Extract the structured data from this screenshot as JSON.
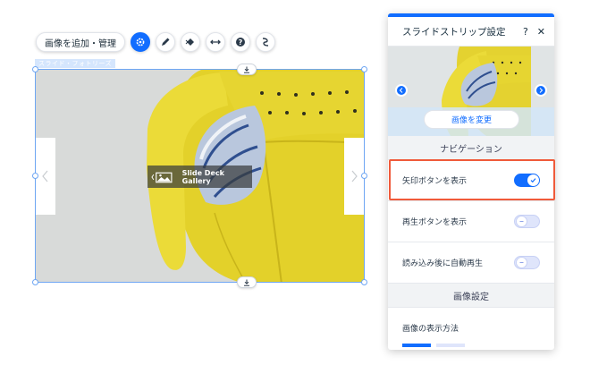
{
  "toolbar": {
    "primary_label": "画像を追加・管理",
    "icons": [
      "gear-icon",
      "pen-icon",
      "animation-icon",
      "stretch-icon",
      "help-icon",
      "connect-icon"
    ]
  },
  "component": {
    "label": "スライド・フォトリーズ",
    "badge_text": "Slide Deck Gallery"
  },
  "panel": {
    "title": "スライドストリップ設定",
    "help": "?",
    "close": "✕",
    "change_image_button": "画像を変更",
    "navigation_section": "ナビゲーション",
    "rows": [
      {
        "label": "矢印ボタンを表示",
        "enabled": true
      },
      {
        "label": "再生ボタンを表示",
        "enabled": false
      },
      {
        "label": "読み込み後に自動再生",
        "enabled": false
      }
    ],
    "image_section": "画像設定",
    "display_method_label": "画像の表示方法"
  },
  "colors": {
    "accent": "#116dff",
    "highlight": "#f05a3a",
    "sofa": "#e8d832"
  }
}
